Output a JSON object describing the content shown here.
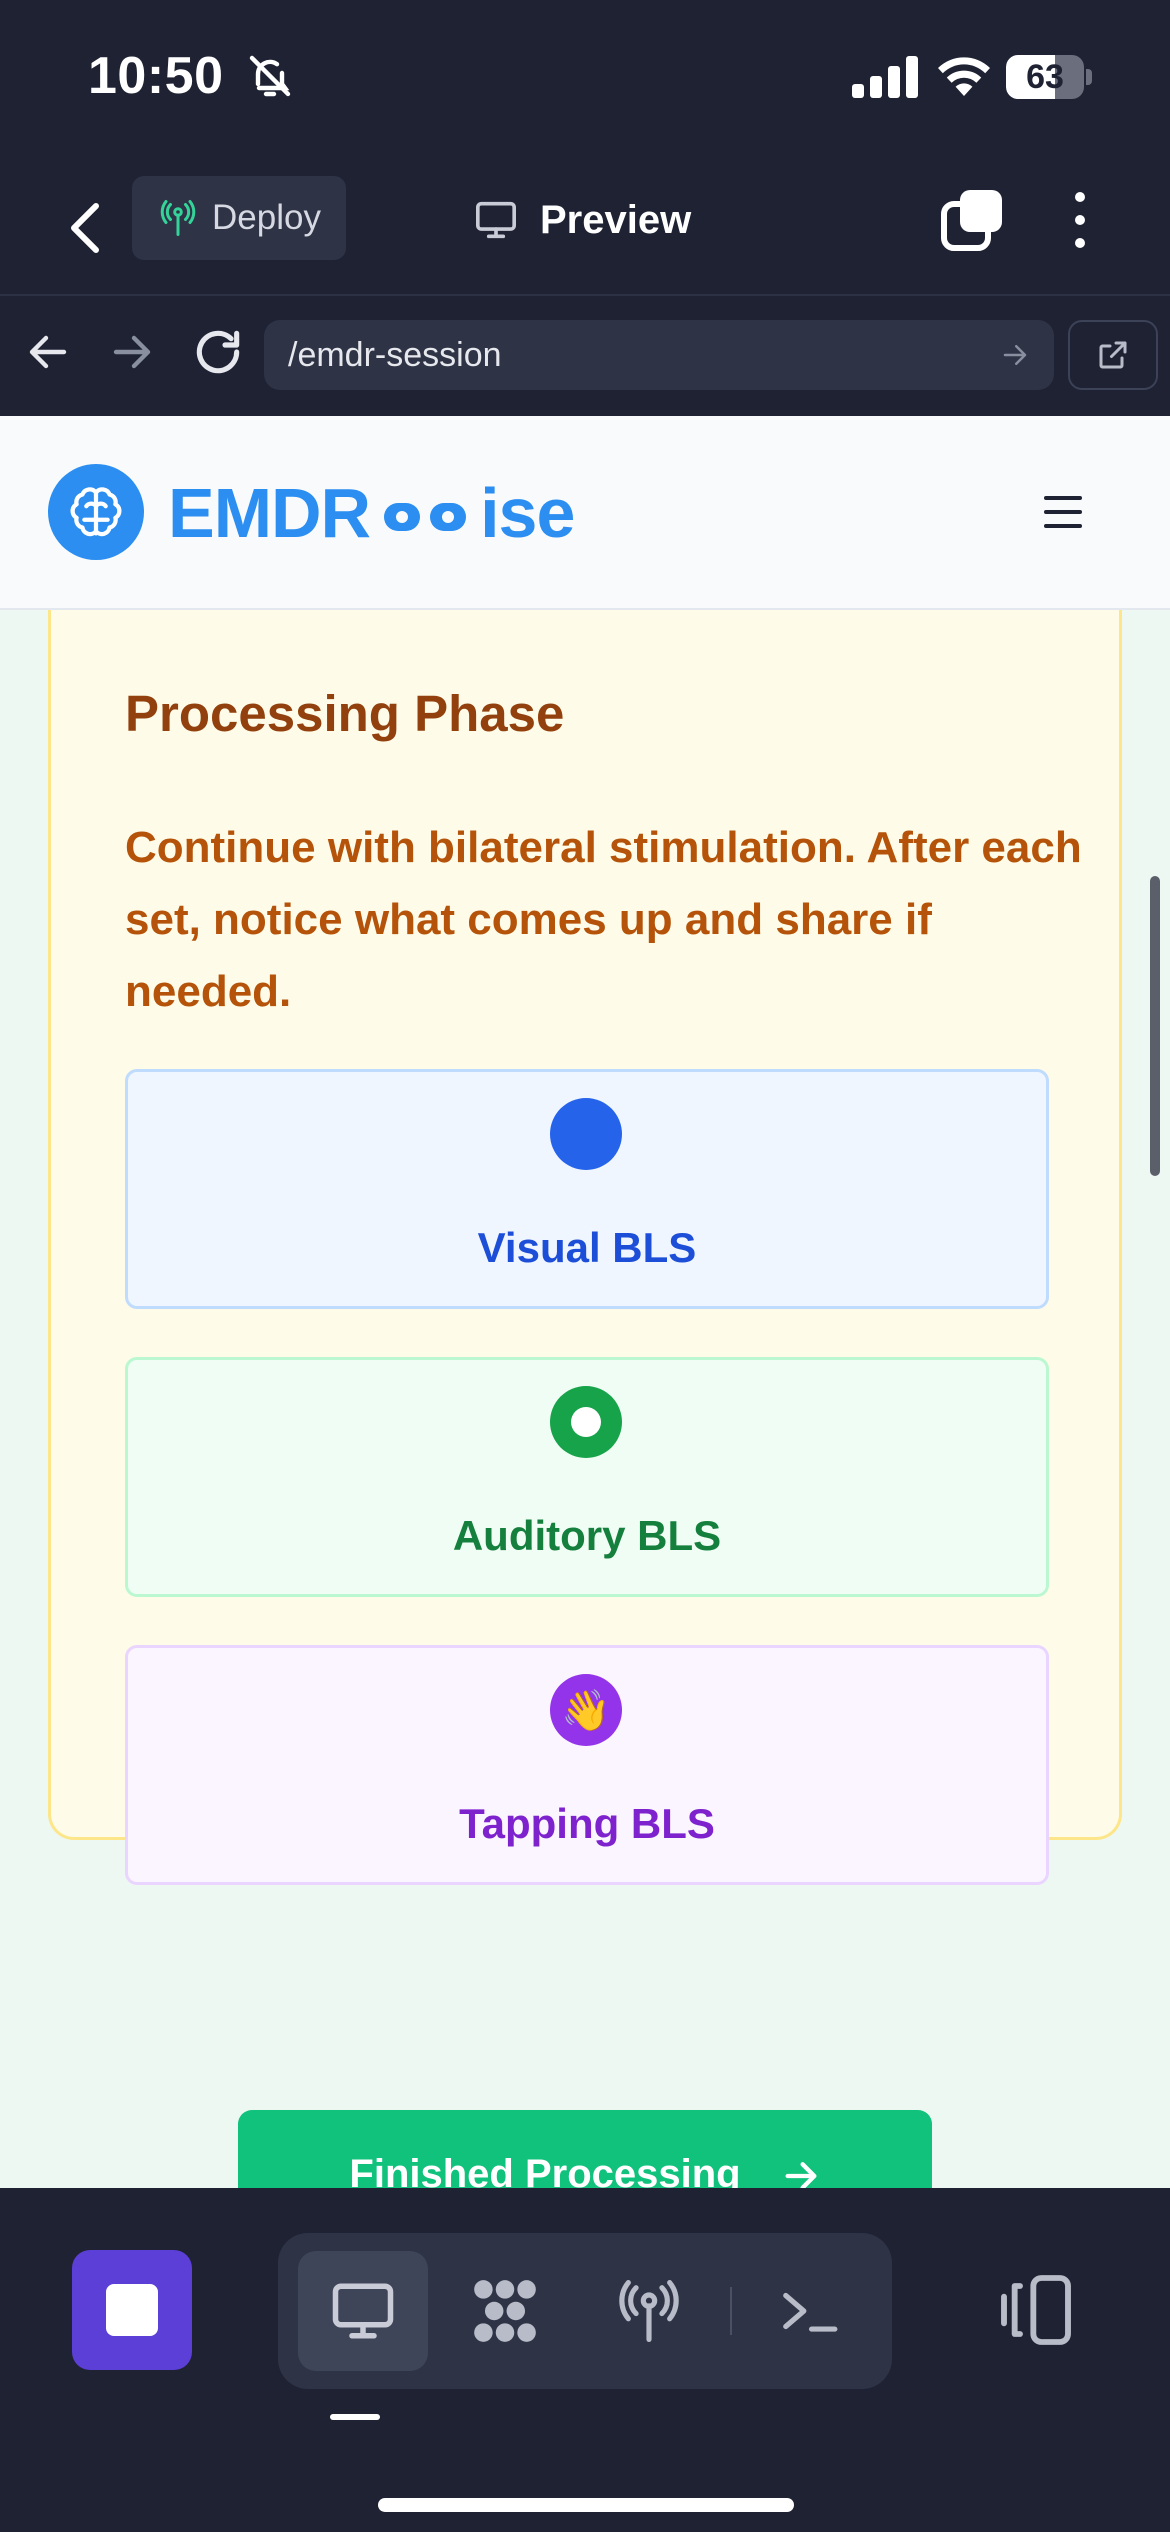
{
  "status_bar": {
    "time": "10:50",
    "battery": "63",
    "battery_level": 0.63
  },
  "toolbar": {
    "deploy_label": "Deploy",
    "preview_label": "Preview"
  },
  "browser": {
    "url": "/emdr-session"
  },
  "site": {
    "logo_text_left": "EMDR",
    "logo_text_right": "ise"
  },
  "phase": {
    "title": "Processing Phase",
    "description": "Continue with bilateral stimulation. After each set, notice what comes up and share if needed.",
    "options": [
      {
        "label": "Visual BLS",
        "icon": "blue-dot-icon",
        "color": "#2563eb"
      },
      {
        "label": "Auditory BLS",
        "icon": "ring-icon",
        "color": "#16a34a"
      },
      {
        "label": "Tapping BLS",
        "icon": "waving-hand-icon",
        "glyph": "👋",
        "color": "#9333ea"
      }
    ]
  },
  "finish": {
    "label": "Finished Processing"
  },
  "colors": {
    "accent": "#2b8ef0",
    "success": "#10c27c",
    "chrome": "#1e2233",
    "stop": "#5b3fd6"
  }
}
